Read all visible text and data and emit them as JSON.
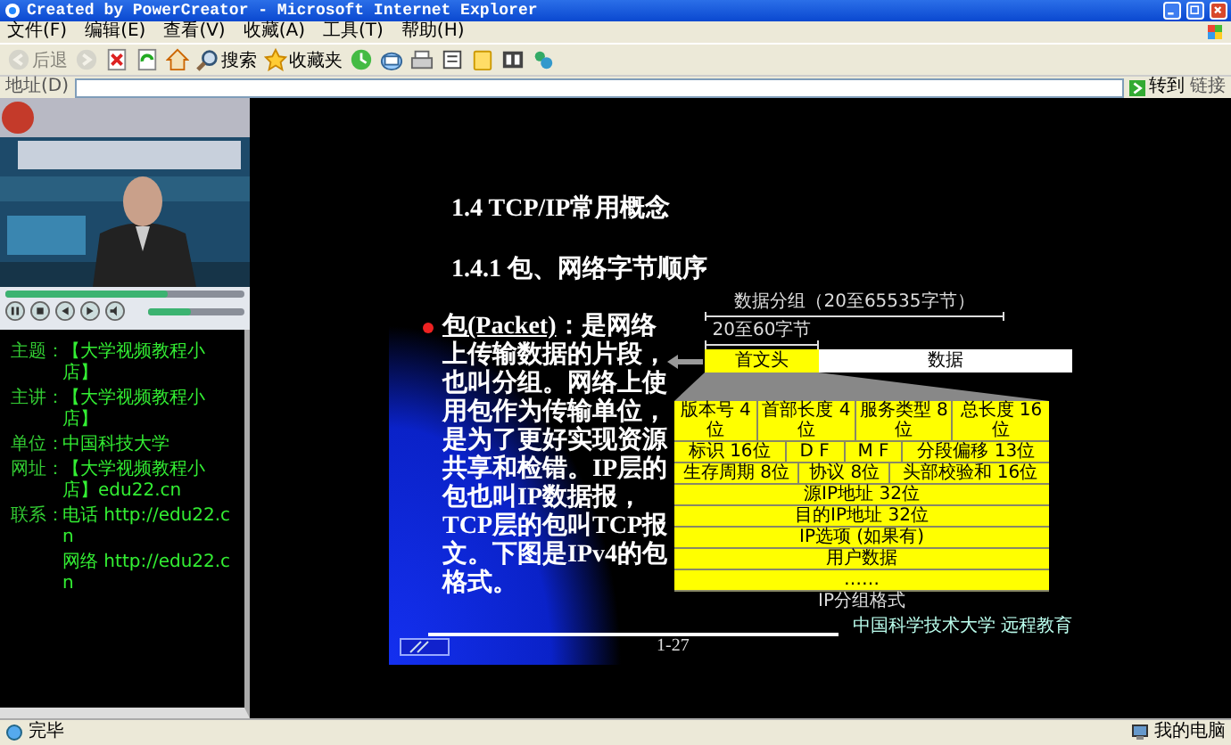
{
  "window": {
    "title": "Created by PowerCreator - Microsoft Internet Explorer"
  },
  "menu": [
    "文件(F)",
    "编辑(E)",
    "查看(V)",
    "收藏(A)",
    "工具(T)",
    "帮助(H)"
  ],
  "toolbar": [
    {
      "label": "后退",
      "disabled": true
    },
    {
      "disabled": true
    },
    {
      "disabled": false
    },
    {
      "disabled": false
    },
    {
      "disabled": false
    },
    {
      "label": "搜索",
      "disabled": false
    },
    {
      "label": "收藏夹",
      "disabled": false
    },
    {
      "disabled": false
    },
    {
      "disabled": false
    },
    {
      "disabled": false
    },
    {
      "disabled": false
    },
    {
      "disabled": false
    },
    {
      "disabled": false
    },
    {
      "disabled": false
    }
  ],
  "address_bar": {
    "label": "地址(D)",
    "go": "转到",
    "links": "链接"
  },
  "player": {
    "seek": {
      "level": 0.68
    },
    "volume": {
      "level": 0.45
    }
  },
  "info": [
    {
      "label": "主题：",
      "value": "【大学视频教程小店】"
    },
    {
      "label": "主讲：",
      "value": "【大学视频教程小店】"
    },
    {
      "label": "单位：",
      "value": "中国科技大学"
    },
    {
      "label": "网址：",
      "value": "【大学视频教程小店】edu22.cn"
    },
    {
      "label": "联系：",
      "value": "电话 http://edu22.cn"
    },
    {
      "value": "网络 http://edu22.cn"
    }
  ],
  "slide": {
    "title": "1.4 TCP/IP常用概念",
    "subtitle": "1.4.1 包、网络字节顺序",
    "bullet": {
      "term": "包(Packet)",
      "text": "：是网络上传输数据的片段，也叫分组。网络上使用包作为传输单位，是为了更好实现资源共享和检错。IP层的包也叫IP数据报，TCP层的包叫TCP报文。下图是IPv4的包格式。"
    },
    "packet": {
      "total": "数据分组（20至65535字节）",
      "header_size": "20至60字节",
      "header": "首文头",
      "data": "数据"
    },
    "ip_header": {
      "rows": [
        [
          "版本号 4位",
          "首部长度 4位",
          "服务类型 8位",
          "总长度 16位"
        ],
        [
          "标识 16位",
          "D F",
          "M F",
          "分段偏移 13位"
        ],
        [
          "生存周期 8位",
          "协议 8位",
          "头部校验和 16位"
        ],
        [
          "源IP地址 32位"
        ],
        [
          "目的IP地址 32位"
        ],
        [
          "IP选项 (如果有)"
        ],
        [
          "用户数据"
        ],
        [
          "……"
        ]
      ],
      "caption": "IP分组格式"
    },
    "page": "1-27",
    "footer": "中国科学技术大学 远程教育"
  },
  "status_bar": {
    "text": "完毕",
    "zone": "我的电脑"
  }
}
